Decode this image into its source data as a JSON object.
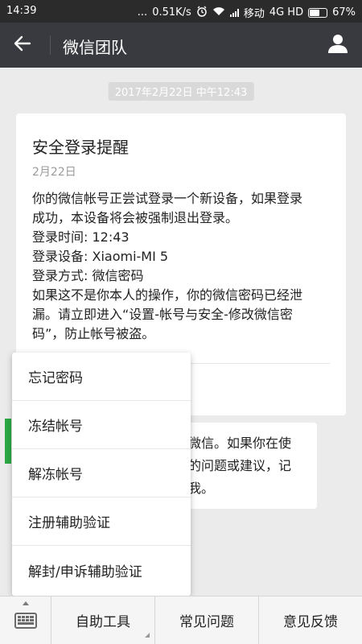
{
  "status": {
    "time": "14:39",
    "dots": "...",
    "speed": "0.51K/s",
    "carrier": "移动",
    "network": "4G HD",
    "battery_text": "67%",
    "battery_level": 0.67
  },
  "header": {
    "title": "微信团队"
  },
  "chat": {
    "timestamp": "2017年2月22日 中午12:43",
    "card": {
      "title": "安全登录提醒",
      "date": "2月22日",
      "lines": [
        "你的微信帐号正尝试登录一个新设备，如果登录",
        "成功，本设备将会被强制退出登录。",
        "登录时间: 12:43",
        "登录设备: Xiaomi-MI 5",
        "登录方式: 微信密码",
        "如果这不是你本人的操作，你的微信密码已经泄",
        "漏。请立即进入“设置-帐号与安全-修改微信密",
        "码”，防止帐号被盗。"
      ]
    },
    "bubble_lines": [
      "微信。如果你在使",
      "的问题或建议，记",
      "我。"
    ]
  },
  "popup_menu": {
    "items": [
      "忘记密码",
      "冻结帐号",
      "解冻帐号",
      "注册辅助验证",
      "解封/申诉辅助验证"
    ]
  },
  "bottom_bar": {
    "tabs": [
      "自助工具",
      "常见问题",
      "意见反馈"
    ]
  },
  "colors": {
    "titlebar": "#393a3f",
    "statusbar": "#2b2b2b",
    "background": "#ebebeb",
    "accent_green": "#2aa743"
  }
}
